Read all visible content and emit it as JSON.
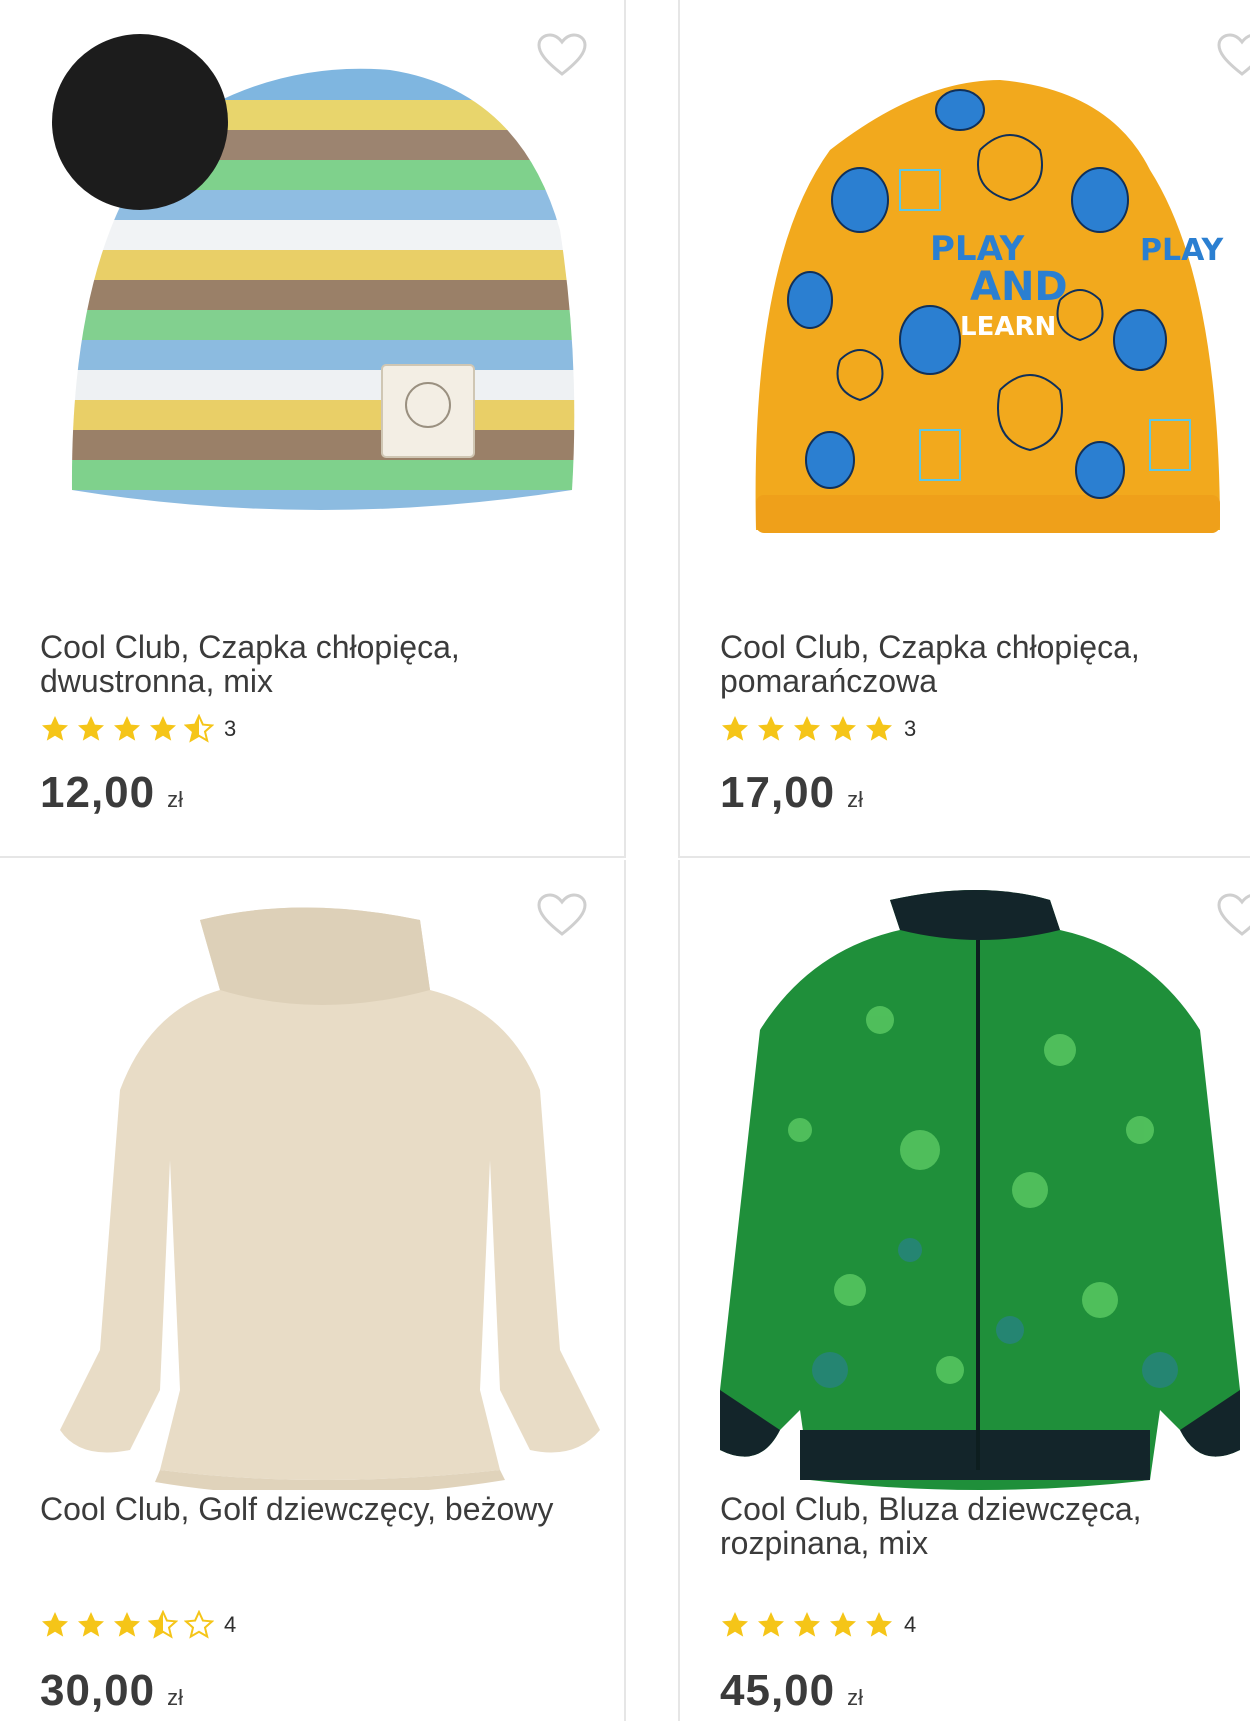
{
  "products": [
    {
      "title": "Cool Club, Czapka chłopięca, dwustronna, mix",
      "rating": 4.5,
      "review_count": "3",
      "price": "12,00",
      "currency": "zł",
      "image_icon": "striped-beanie-image"
    },
    {
      "title": "Cool Club, Czapka chłopięca, pomarańczowa",
      "rating": 5,
      "review_count": "3",
      "price": "17,00",
      "currency": "zł",
      "image_icon": "orange-monster-beanie-image"
    },
    {
      "title": "Cool Club, Golf dziewczęcy, beżowy",
      "rating": 3.5,
      "review_count": "4",
      "price": "30,00",
      "currency": "zł",
      "image_icon": "beige-turtleneck-image"
    },
    {
      "title": "Cool Club, Bluza dziewczęca, rozpinana, mix",
      "rating": 5,
      "review_count": "4",
      "price": "45,00",
      "currency": "zł",
      "image_icon": "green-sequin-jacket-image"
    }
  ],
  "colors": {
    "star_filled": "#F5C518",
    "star_empty_stroke": "#F5C518",
    "divider": "#E6E6E6",
    "text": "#3B3B3B"
  }
}
